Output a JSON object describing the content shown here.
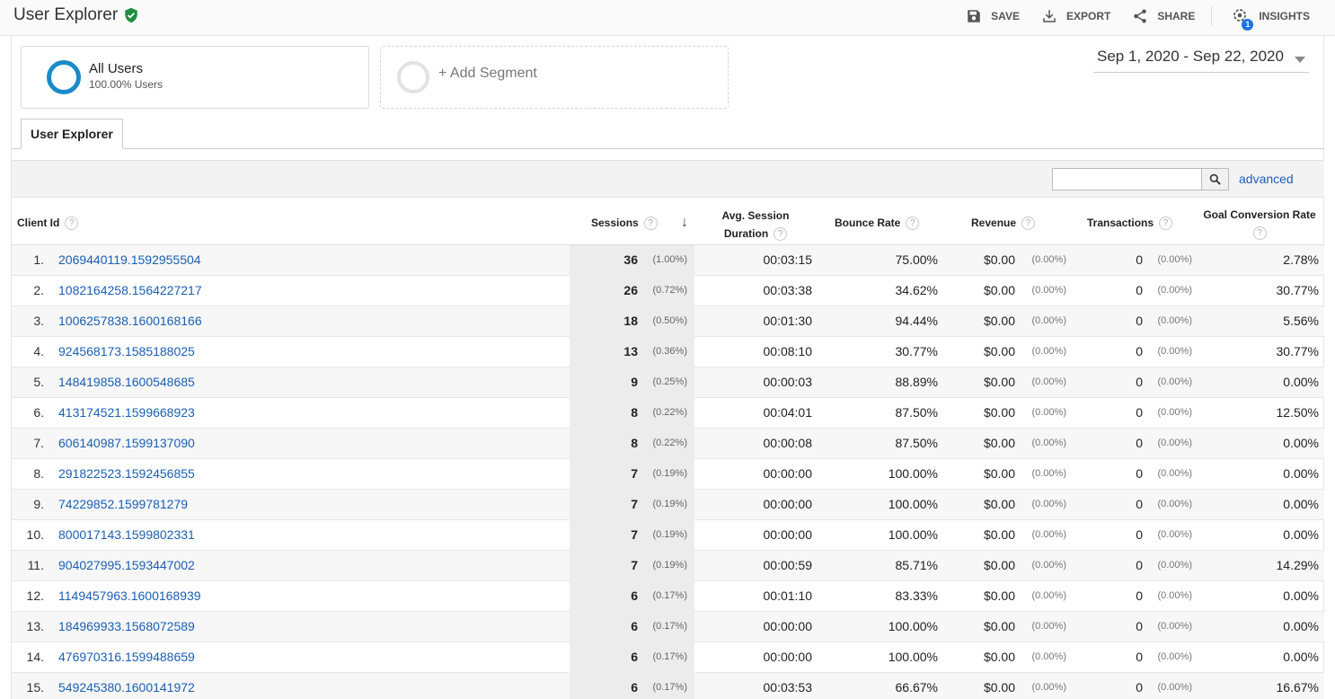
{
  "header": {
    "title": "User Explorer",
    "actions": {
      "save": "SAVE",
      "export": "EXPORT",
      "share": "SHARE",
      "insights": "INSIGHTS",
      "insights_badge": "1"
    }
  },
  "segments": {
    "all_users_name": "All Users",
    "all_users_sub": "100.00% Users",
    "add_segment": "+ Add Segment"
  },
  "date_range": "Sep 1, 2020 - Sep 22, 2020",
  "tab": "User Explorer",
  "toolbar": {
    "search_value": "",
    "advanced": "advanced"
  },
  "columns": {
    "client_id": "Client Id",
    "sessions": "Sessions",
    "avg_session_1": "Avg. Session",
    "avg_session_2": "Duration",
    "bounce_rate": "Bounce Rate",
    "revenue": "Revenue",
    "transactions": "Transactions",
    "goal_conversion": "Goal Conversion Rate"
  },
  "rows": [
    {
      "idx": "1.",
      "id": "2069440119.1592955504",
      "sessions": "36",
      "sessions_pct": "(1.00%)",
      "duration": "00:03:15",
      "bounce": "75.00%",
      "revenue": "$0.00",
      "revenue_pct": "(0.00%)",
      "transactions": "0",
      "transactions_pct": "(0.00%)",
      "gcr": "2.78%"
    },
    {
      "idx": "2.",
      "id": "1082164258.1564227217",
      "sessions": "26",
      "sessions_pct": "(0.72%)",
      "duration": "00:03:38",
      "bounce": "34.62%",
      "revenue": "$0.00",
      "revenue_pct": "(0.00%)",
      "transactions": "0",
      "transactions_pct": "(0.00%)",
      "gcr": "30.77%"
    },
    {
      "idx": "3.",
      "id": "1006257838.1600168166",
      "sessions": "18",
      "sessions_pct": "(0.50%)",
      "duration": "00:01:30",
      "bounce": "94.44%",
      "revenue": "$0.00",
      "revenue_pct": "(0.00%)",
      "transactions": "0",
      "transactions_pct": "(0.00%)",
      "gcr": "5.56%"
    },
    {
      "idx": "4.",
      "id": "924568173.1585188025",
      "sessions": "13",
      "sessions_pct": "(0.36%)",
      "duration": "00:08:10",
      "bounce": "30.77%",
      "revenue": "$0.00",
      "revenue_pct": "(0.00%)",
      "transactions": "0",
      "transactions_pct": "(0.00%)",
      "gcr": "30.77%"
    },
    {
      "idx": "5.",
      "id": "148419858.1600548685",
      "sessions": "9",
      "sessions_pct": "(0.25%)",
      "duration": "00:00:03",
      "bounce": "88.89%",
      "revenue": "$0.00",
      "revenue_pct": "(0.00%)",
      "transactions": "0",
      "transactions_pct": "(0.00%)",
      "gcr": "0.00%"
    },
    {
      "idx": "6.",
      "id": "413174521.1599668923",
      "sessions": "8",
      "sessions_pct": "(0.22%)",
      "duration": "00:04:01",
      "bounce": "87.50%",
      "revenue": "$0.00",
      "revenue_pct": "(0.00%)",
      "transactions": "0",
      "transactions_pct": "(0.00%)",
      "gcr": "12.50%"
    },
    {
      "idx": "7.",
      "id": "606140987.1599137090",
      "sessions": "8",
      "sessions_pct": "(0.22%)",
      "duration": "00:00:08",
      "bounce": "87.50%",
      "revenue": "$0.00",
      "revenue_pct": "(0.00%)",
      "transactions": "0",
      "transactions_pct": "(0.00%)",
      "gcr": "0.00%"
    },
    {
      "idx": "8.",
      "id": "291822523.1592456855",
      "sessions": "7",
      "sessions_pct": "(0.19%)",
      "duration": "00:00:00",
      "bounce": "100.00%",
      "revenue": "$0.00",
      "revenue_pct": "(0.00%)",
      "transactions": "0",
      "transactions_pct": "(0.00%)",
      "gcr": "0.00%"
    },
    {
      "idx": "9.",
      "id": "74229852.1599781279",
      "sessions": "7",
      "sessions_pct": "(0.19%)",
      "duration": "00:00:00",
      "bounce": "100.00%",
      "revenue": "$0.00",
      "revenue_pct": "(0.00%)",
      "transactions": "0",
      "transactions_pct": "(0.00%)",
      "gcr": "0.00%"
    },
    {
      "idx": "10.",
      "id": "800017143.1599802331",
      "sessions": "7",
      "sessions_pct": "(0.19%)",
      "duration": "00:00:00",
      "bounce": "100.00%",
      "revenue": "$0.00",
      "revenue_pct": "(0.00%)",
      "transactions": "0",
      "transactions_pct": "(0.00%)",
      "gcr": "0.00%"
    },
    {
      "idx": "11.",
      "id": "904027995.1593447002",
      "sessions": "7",
      "sessions_pct": "(0.19%)",
      "duration": "00:00:59",
      "bounce": "85.71%",
      "revenue": "$0.00",
      "revenue_pct": "(0.00%)",
      "transactions": "0",
      "transactions_pct": "(0.00%)",
      "gcr": "14.29%"
    },
    {
      "idx": "12.",
      "id": "1149457963.1600168939",
      "sessions": "6",
      "sessions_pct": "(0.17%)",
      "duration": "00:01:10",
      "bounce": "83.33%",
      "revenue": "$0.00",
      "revenue_pct": "(0.00%)",
      "transactions": "0",
      "transactions_pct": "(0.00%)",
      "gcr": "0.00%"
    },
    {
      "idx": "13.",
      "id": "184969933.1568072589",
      "sessions": "6",
      "sessions_pct": "(0.17%)",
      "duration": "00:00:00",
      "bounce": "100.00%",
      "revenue": "$0.00",
      "revenue_pct": "(0.00%)",
      "transactions": "0",
      "transactions_pct": "(0.00%)",
      "gcr": "0.00%"
    },
    {
      "idx": "14.",
      "id": "476970316.1599488659",
      "sessions": "6",
      "sessions_pct": "(0.17%)",
      "duration": "00:00:00",
      "bounce": "100.00%",
      "revenue": "$0.00",
      "revenue_pct": "(0.00%)",
      "transactions": "0",
      "transactions_pct": "(0.00%)",
      "gcr": "0.00%"
    },
    {
      "idx": "15.",
      "id": "549245380.1600141972",
      "sessions": "6",
      "sessions_pct": "(0.17%)",
      "duration": "00:03:53",
      "bounce": "66.67%",
      "revenue": "$0.00",
      "revenue_pct": "(0.00%)",
      "transactions": "0",
      "transactions_pct": "(0.00%)",
      "gcr": "16.67%"
    }
  ],
  "colors": {
    "link": "#1a5fb4",
    "segment_ring": "#1a8bc9",
    "verified_shield": "#1e8e3e",
    "sorted_column_bg": "#ececec",
    "insights_badge": "#1a73e8"
  },
  "icons": {
    "verified": "shield-check-icon",
    "save": "floppy-disk-icon",
    "export": "download-icon",
    "share": "share-icon",
    "insights": "insights-icon",
    "search": "magnifier-icon",
    "help": "question-mark-icon",
    "sort": "arrow-down-icon",
    "date_dropdown": "caret-down-icon"
  }
}
